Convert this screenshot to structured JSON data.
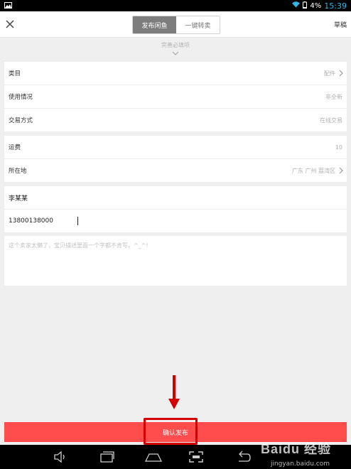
{
  "status_bar": {
    "battery": "4%",
    "time": "15:39"
  },
  "header": {
    "tabs": [
      {
        "label": "发布闲鱼",
        "active": true
      },
      {
        "label": "一键转卖",
        "active": false
      }
    ],
    "draft_label": "草稿"
  },
  "required_hint": "完善必填项",
  "group1": [
    {
      "label": "类目",
      "value": "配件"
    },
    {
      "label": "使用情况",
      "value": "非全新"
    },
    {
      "label": "交易方式",
      "value": "在线交易"
    }
  ],
  "group2": [
    {
      "label": "运费",
      "value": "10"
    },
    {
      "label": "所在地",
      "value": "广东 广州 荔湾区"
    }
  ],
  "contact": {
    "name": "李某某",
    "phone": "13800138000"
  },
  "description_placeholder": "这个卖家太懒了，宝贝描述里面一个字都不肯写。^_^!",
  "submit_label": "确认发布",
  "watermark": {
    "text": "Baidu 经验",
    "url": "jingyan.baidu.com"
  },
  "colors": {
    "accent": "#ff4c4c",
    "tab_active": "#7d7d7d",
    "annotation": "#d40000"
  }
}
